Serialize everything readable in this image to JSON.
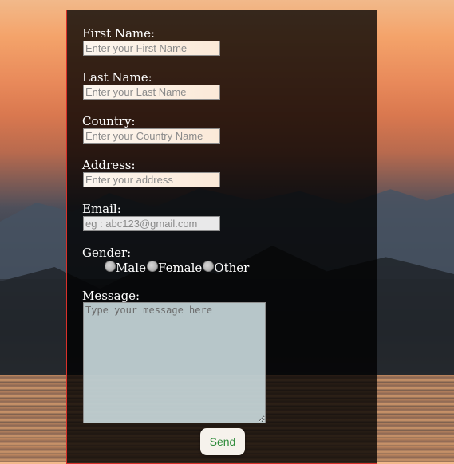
{
  "form": {
    "first_name": {
      "label": "First Name:",
      "placeholder": "Enter your First Name"
    },
    "last_name": {
      "label": "Last Name:",
      "placeholder": "Enter your Last Name"
    },
    "country": {
      "label": "Country:",
      "placeholder": "Enter your Country Name"
    },
    "address": {
      "label": "Address:",
      "placeholder": "Enter your address"
    },
    "email": {
      "label": "Email:",
      "placeholder": "eg : abc123@gmail.com"
    },
    "gender": {
      "label": "Gender:",
      "options": [
        "Male",
        "Female",
        "Other"
      ]
    },
    "message": {
      "label": "Message:",
      "placeholder": "Type your message here"
    },
    "send_label": "Send"
  },
  "colors": {
    "panel_border": "#d9302a",
    "send_text": "#2e8b3a"
  }
}
